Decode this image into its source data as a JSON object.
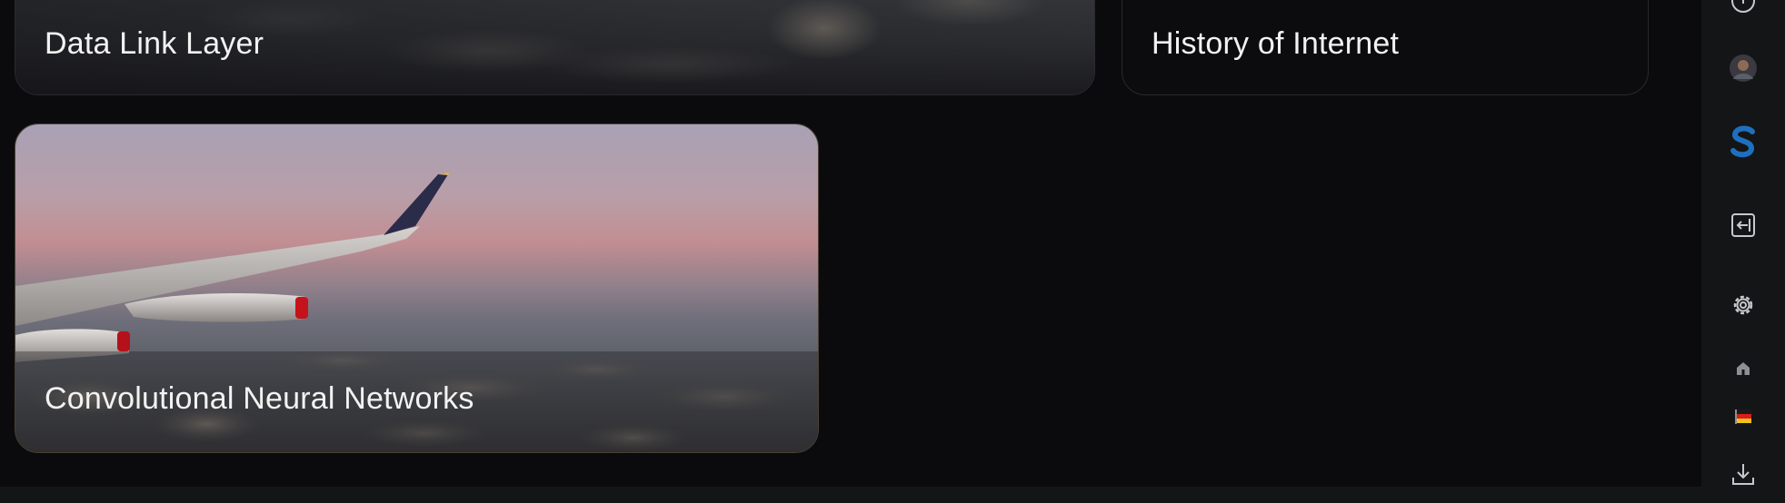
{
  "cards": [
    {
      "title": "Data Link Layer"
    },
    {
      "title": "History of Internet"
    },
    {
      "title": "Convolutional Neural Networks"
    }
  ],
  "sidebar": {
    "items": [
      {
        "icon": "info-icon"
      },
      {
        "icon": "avatar"
      },
      {
        "icon": "s-logo-icon"
      },
      {
        "icon": "collapse-panel-icon"
      },
      {
        "icon": "settings-gear-icon"
      },
      {
        "icon": "home-icon"
      },
      {
        "icon": "flag-icon"
      },
      {
        "icon": "download-icon"
      }
    ]
  },
  "colors": {
    "background": "#0b0b0d",
    "sidebar": "#141517",
    "card_border": "#2a2a2d",
    "text": "#f2f2f2",
    "icon": "#c8c8cc",
    "brand_s": "#1f6fbf"
  }
}
